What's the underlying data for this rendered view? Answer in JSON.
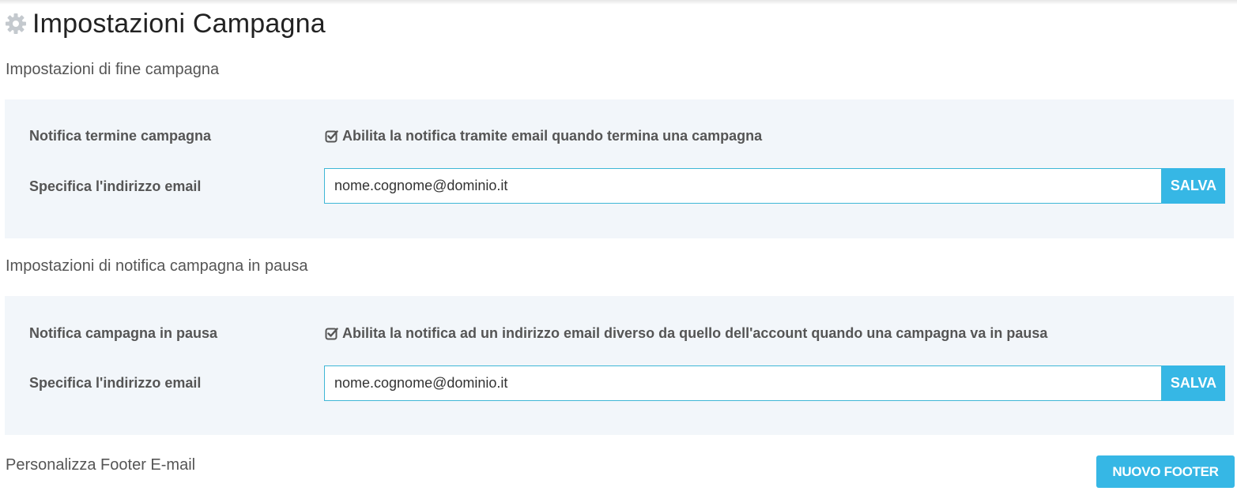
{
  "header": {
    "title": "Impostazioni Campagna",
    "icon": "gear-icon"
  },
  "sections": [
    {
      "title": "Impostazioni di fine campagna",
      "notify_label": "Notifica termine campagna",
      "checkbox_label": "Abilita la notifica tramite email quando termina una campagna",
      "checkbox_checked": true,
      "email_label": "Specifica l'indirizzo email",
      "email_value": "nome.cognome@dominio.it",
      "save_label": "SALVA"
    },
    {
      "title": "Impostazioni di notifica campagna in pausa",
      "notify_label": "Notifica campagna in pausa",
      "checkbox_label": "Abilita la notifica ad un indirizzo email diverso da quello dell'account quando una campagna va in pausa",
      "checkbox_checked": true,
      "email_label": "Specifica l'indirizzo email",
      "email_value": "nome.cognome@dominio.it",
      "save_label": "SALVA"
    }
  ],
  "footer_section": {
    "title": "Personalizza Footer E-mail",
    "new_footer_label": "NUOVO FOOTER"
  },
  "colors": {
    "accent": "#36b7e5",
    "input_border": "#3fb7d6",
    "panel_bg": "#f2f6fa",
    "icon_gray": "#c4c9ce"
  }
}
